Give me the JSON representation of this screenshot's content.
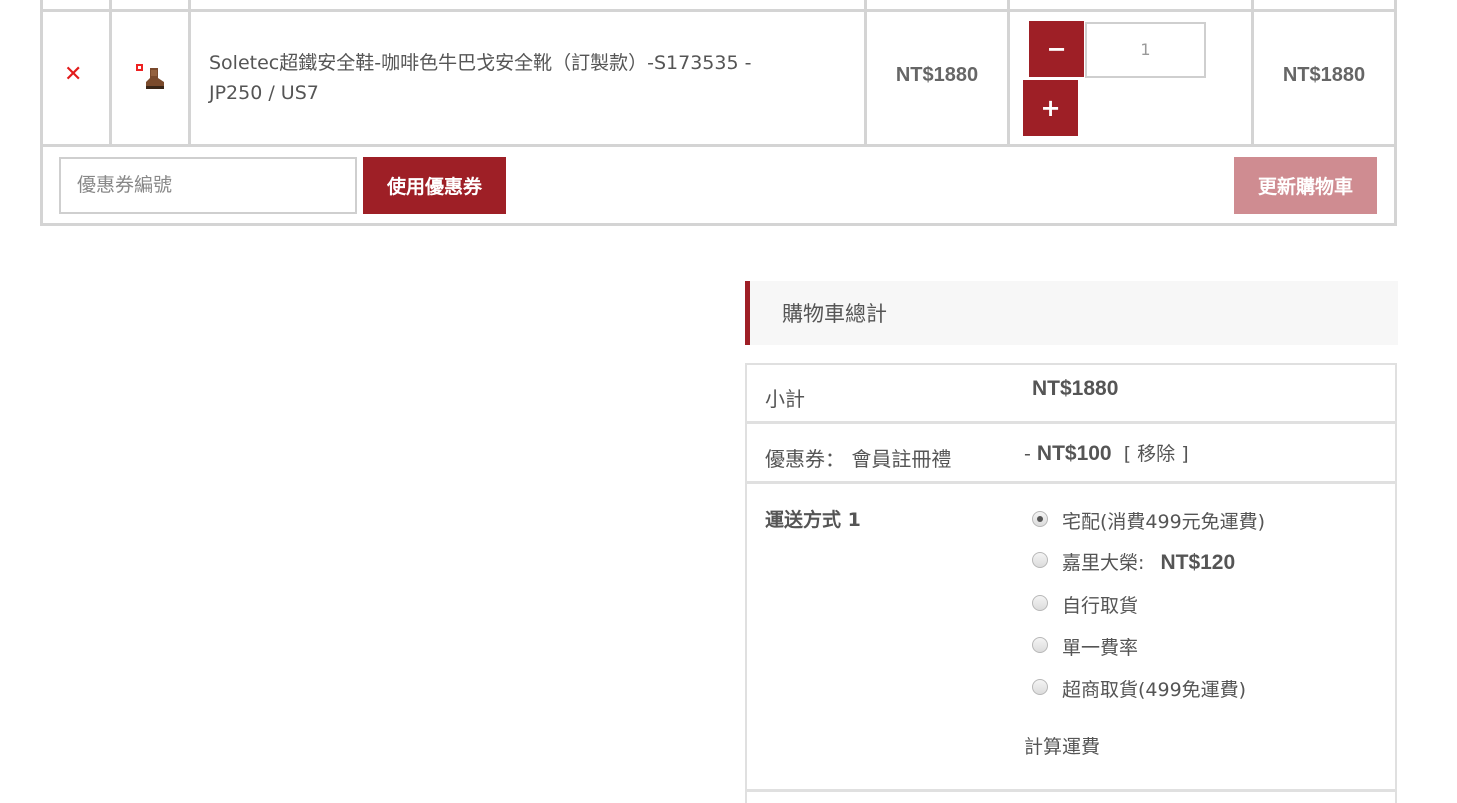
{
  "cart": {
    "remove_symbol": "✕",
    "item": {
      "name": "Soletec超鐵安全鞋-咖啡色牛巴戈安全靴（訂製款）-S173535 - JP250 / US7",
      "name_line1": "Soletec超鐵安全鞋-咖啡色牛巴戈安全靴（訂製款）-S173535 -",
      "name_line2": "JP250 / US7",
      "price": "NT$1880",
      "quantity": "1",
      "subtotal": "NT$1880"
    },
    "minus_symbol": "−",
    "plus_symbol": "+"
  },
  "coupon": {
    "placeholder": "優惠券編號",
    "apply_label": "使用優惠券",
    "update_label": "更新購物車"
  },
  "totals": {
    "title": "購物車總計",
    "subtotal_label": "小計",
    "subtotal_value": "NT$1880",
    "coupon_label": "優惠券： 會員註冊禮",
    "coupon_prefix": "-",
    "coupon_value": "NT$100",
    "coupon_remove": "[ 移除 ]",
    "shipping_label": "運送方式 1",
    "shipping_options": [
      {
        "label": "宅配(消費499元免運費)",
        "price": "",
        "checked": true
      },
      {
        "label": "嘉里大榮:",
        "price": "NT$120",
        "checked": false
      },
      {
        "label": "自行取貨",
        "price": "",
        "checked": false
      },
      {
        "label": "單一費率",
        "price": "",
        "checked": false
      },
      {
        "label": "超商取貨(499免運費)",
        "price": "",
        "checked": false
      }
    ],
    "calc_shipping": "計算運費"
  },
  "colors": {
    "accent": "#9e1f26",
    "accent_light": "#cf8c91",
    "remove": "#e21b1b"
  }
}
